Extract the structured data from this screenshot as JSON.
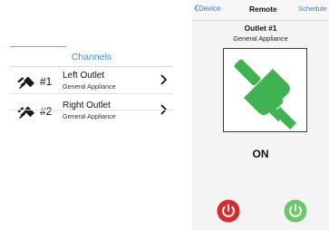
{
  "channels": {
    "header": "Channels",
    "items": [
      {
        "number": "#1",
        "name": "Left Outlet",
        "type": "General Appliance",
        "icon": "plug-icon"
      },
      {
        "number": "#2",
        "name": "Right Outlet",
        "type": "General Appliance",
        "icon": "plug-icon"
      }
    ]
  },
  "nav": {
    "back_label": "Device",
    "title": "Remote",
    "schedule_label": "Schedule"
  },
  "outlet": {
    "title": "Outlet #1",
    "type": "General Appliance",
    "state": "ON",
    "plug_color": "#3fb34f"
  },
  "controls": {
    "off_button": {
      "icon": "power-icon",
      "color": "#d92b2b"
    },
    "on_button": {
      "icon": "power-icon",
      "color": "#6cc76a"
    }
  }
}
